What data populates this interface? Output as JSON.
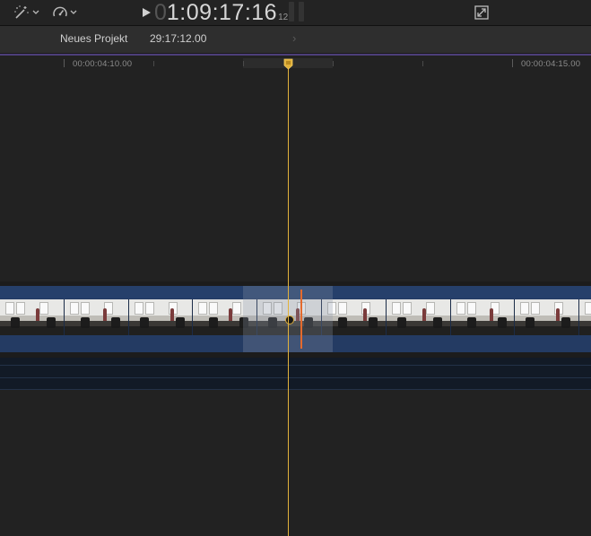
{
  "toolbar": {
    "enhance_icon": "magic-wand-icon",
    "speed_icon": "speedometer-icon",
    "play_icon": "play-icon",
    "fullscreen_icon": "fullscreen-icon"
  },
  "timecode": {
    "dim_prefix": "0",
    "main": "1:09:17:16",
    "frames": "12"
  },
  "project": {
    "name": "Neues Projekt",
    "duration": "29:17:12.00",
    "forward_glyph": "›"
  },
  "ruler": {
    "label_left": "00:00:04:10.00",
    "label_right": "00:00:04:15.00"
  },
  "colors": {
    "background": "#222222",
    "clip": "#243b63",
    "playhead": "#e2b23b",
    "skimmer": "#e46a2d",
    "accent": "#4d3f7a"
  }
}
